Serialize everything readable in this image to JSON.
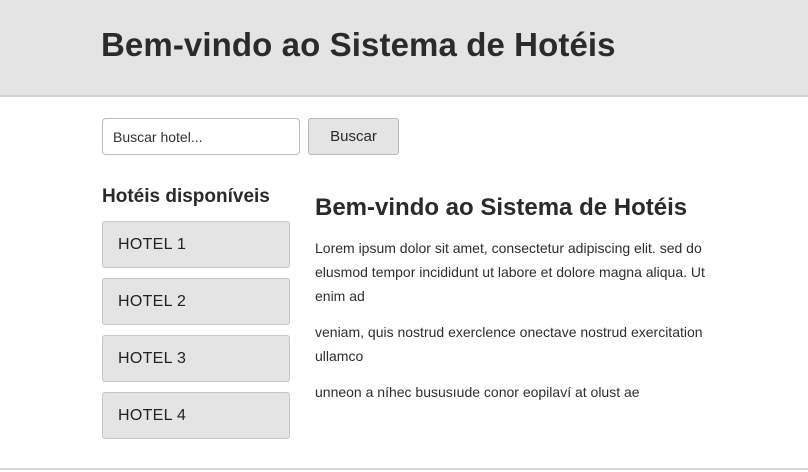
{
  "header": {
    "title": "Bem-vindo ao Sistema de Hotéis"
  },
  "search": {
    "placeholder": "Buscar hotel...",
    "value": "",
    "button_label": "Buscar"
  },
  "sidebar": {
    "title": "Hotéis disponíveis",
    "items": [
      {
        "label": "HOTEL 1"
      },
      {
        "label": "HOTEL 2"
      },
      {
        "label": "HOTEL 3"
      },
      {
        "label": "HOTEL 4"
      }
    ]
  },
  "main": {
    "title": "Bem-vindo ao Sistema de Hotéis",
    "paragraphs": [
      "Lorem ipsum dolor sit amet, consectetur adipiscing elit. sed do elusmod tempor incididunt ut labore et dolore magna aliqua. Ut enim ad",
      "veniam, quis nostrud exerclence onectave nostrud exercitation ullamco",
      "unneon a níhec bususıude conor eopilaví at olust ae"
    ]
  },
  "colors": {
    "header_bg": "#e4e4e4",
    "button_bg": "#e4e4e4",
    "page_bg": "#ffffff"
  }
}
